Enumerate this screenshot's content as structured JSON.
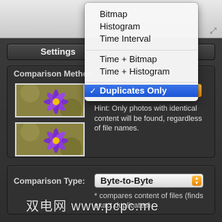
{
  "tabs": [
    {
      "label": "Settings"
    }
  ],
  "comparison_method": {
    "heading": "Comparison Method",
    "hint": "Hint: Only photos with identical content will be found, regardless of file names."
  },
  "menu": {
    "items": [
      {
        "label": "Bitmap",
        "selected": false
      },
      {
        "label": "Histogram",
        "selected": false
      },
      {
        "label": "Time Interval",
        "selected": false
      },
      {
        "label": "Time + Bitmap",
        "selected": false
      },
      {
        "label": "Time + Histogram",
        "selected": false
      },
      {
        "label": "Duplicates Only",
        "selected": true
      }
    ],
    "check": "✓"
  },
  "comparison_type": {
    "label": "Comparison Type:",
    "value": "Byte-to-Byte",
    "hint": "* compares content of files (finds exact duplicates)"
  },
  "watermark": "双电网 www.pcpc.me",
  "colors": {
    "accent": "#f08a00",
    "selection": "#1a55d6",
    "panel": "#313131"
  },
  "icons": {
    "expand": "expand-arrows-icon",
    "stepper": "up-down-stepper-icon",
    "check": "checkmark-icon"
  }
}
